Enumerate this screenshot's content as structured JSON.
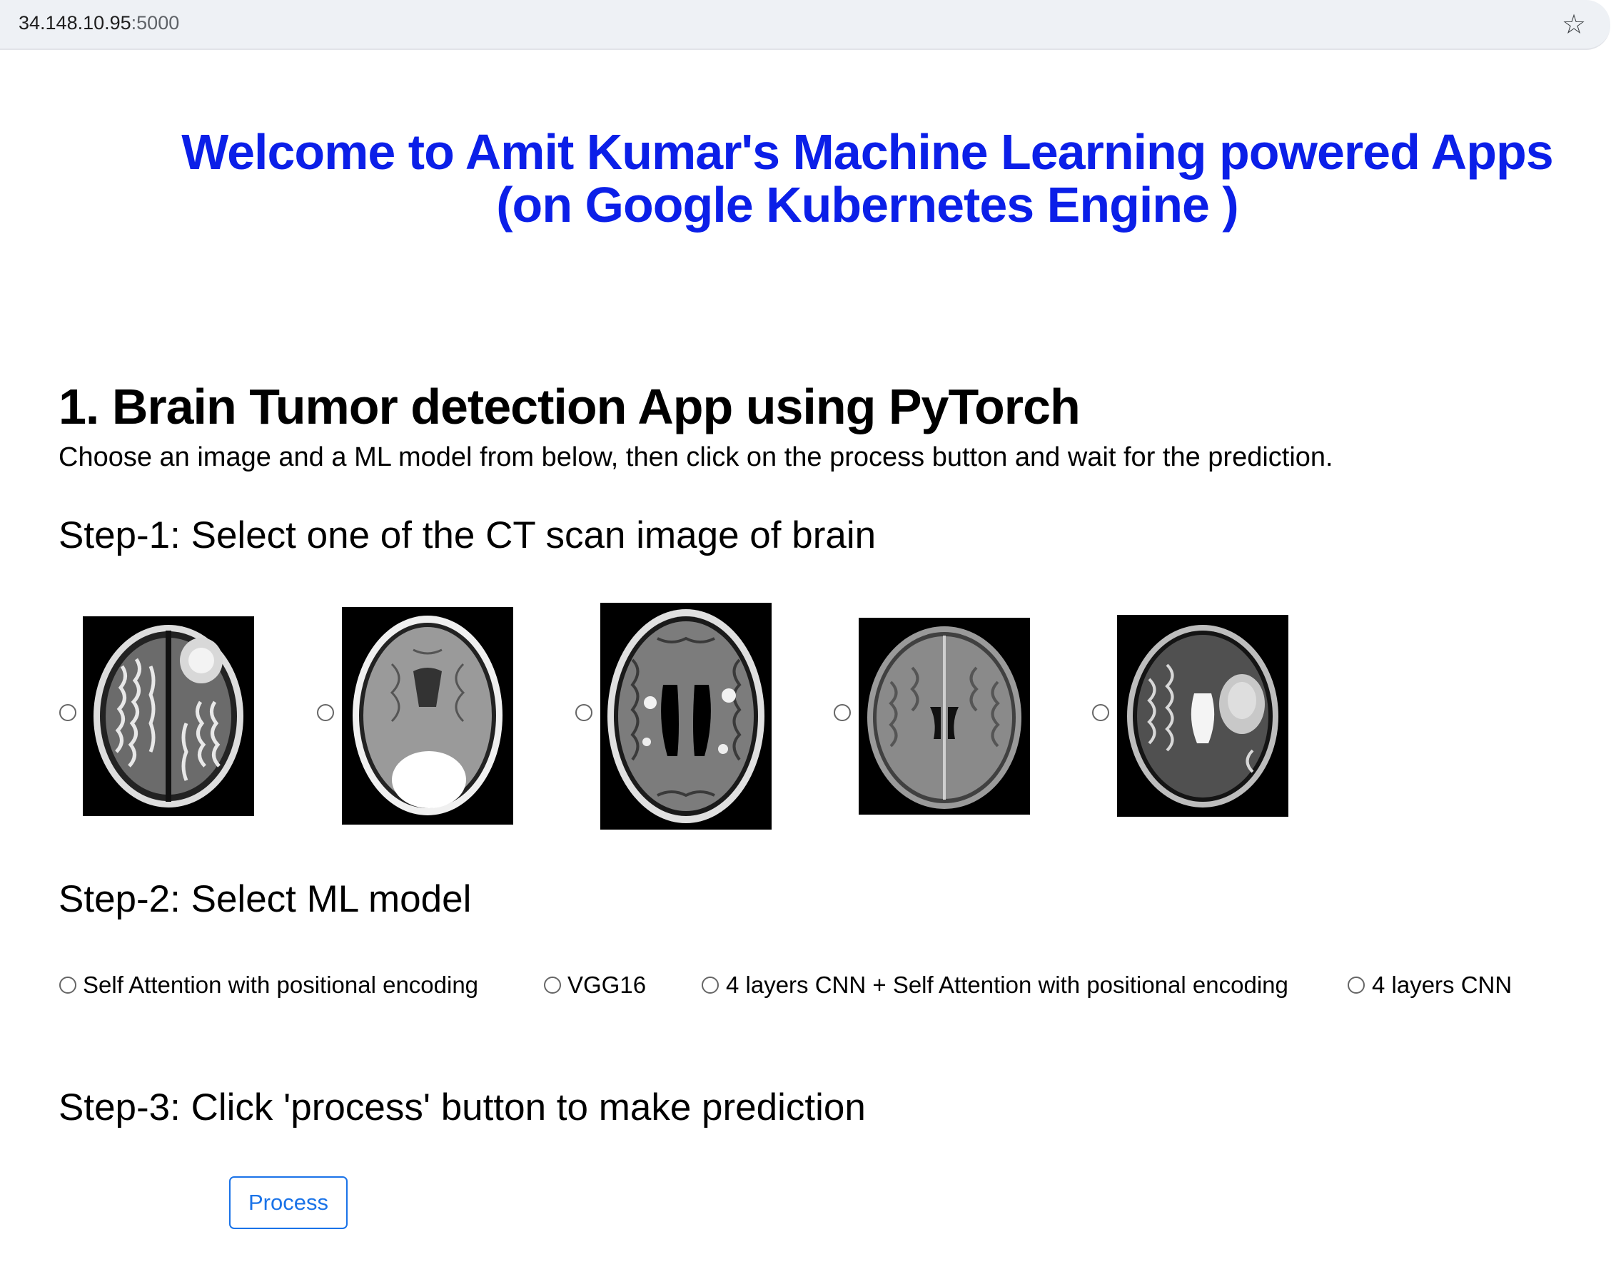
{
  "browser": {
    "url_host": "34.148.10.95",
    "url_port": ":5000"
  },
  "page": {
    "title_line1": "Welcome to Amit Kumar's Machine Learning powered Apps",
    "title_line2": "(on Google Kubernetes Engine )",
    "app_heading": "1. Brain Tumor detection App using PyTorch",
    "instructions": "Choose an image and a ML model from below, then click on the process button and wait for the prediction.",
    "step1": "Step-1: Select one of the CT scan image of brain",
    "step2": "Step-2: Select ML model",
    "step3": "Step-3: Click 'process' button to make prediction"
  },
  "images": [
    {
      "name": "brain-scan-1",
      "selected": false
    },
    {
      "name": "brain-scan-2",
      "selected": false
    },
    {
      "name": "brain-scan-3",
      "selected": false
    },
    {
      "name": "brain-scan-4",
      "selected": false
    },
    {
      "name": "brain-scan-5",
      "selected": false
    }
  ],
  "models": [
    {
      "label": "Self Attention with positional encoding",
      "selected": false
    },
    {
      "label": "VGG16",
      "selected": false
    },
    {
      "label": "4 layers CNN + Self Attention with positional encoding",
      "selected": false
    },
    {
      "label": "4 layers CNN",
      "selected": false
    }
  ],
  "buttons": {
    "process": "Process"
  },
  "colors": {
    "title": "#0b1fe8",
    "button_accent": "#1a73e8"
  },
  "icons": {
    "bookmark": "star-icon"
  }
}
